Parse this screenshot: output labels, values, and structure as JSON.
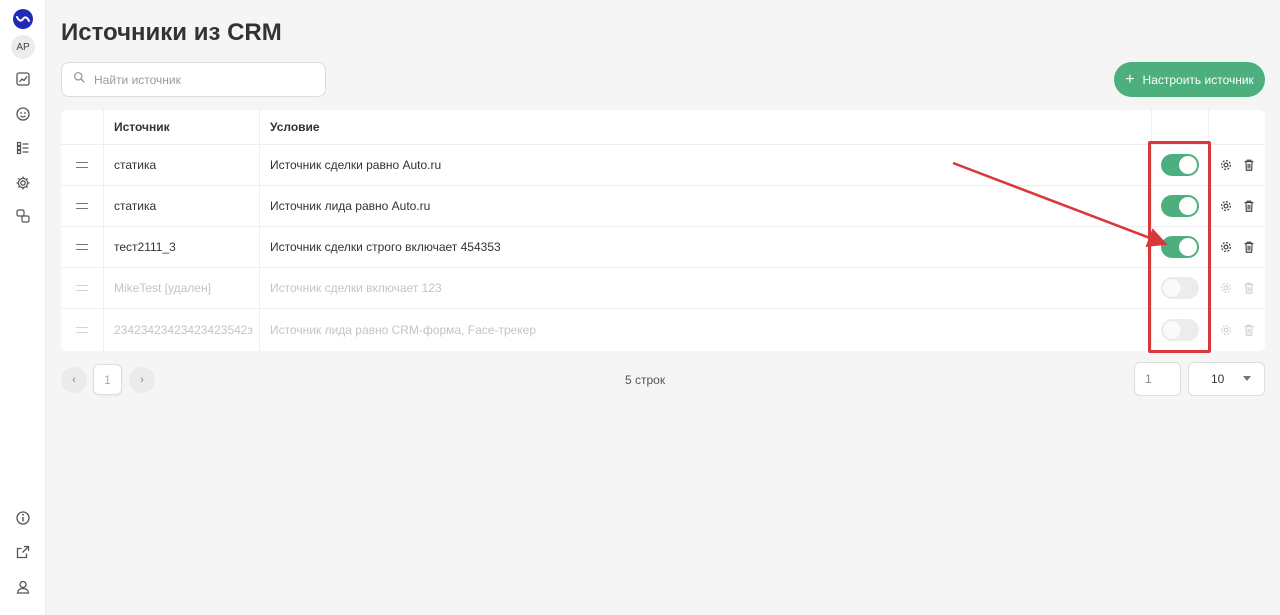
{
  "sidebar": {
    "avatar_initials": "AP",
    "items": [
      {
        "icon": "analytics-icon"
      },
      {
        "icon": "emoji-icon"
      },
      {
        "icon": "list-icon"
      },
      {
        "icon": "gear-icon"
      },
      {
        "icon": "integrations-icon"
      }
    ],
    "bottom_items": [
      {
        "icon": "info-icon"
      },
      {
        "icon": "external-link-icon"
      },
      {
        "icon": "user-icon"
      }
    ]
  },
  "page": {
    "title": "Источники из CRM"
  },
  "search": {
    "placeholder": "Найти источник",
    "value": ""
  },
  "actions": {
    "add_label": "Настроить источник",
    "add_icon": "plus-icon"
  },
  "table": {
    "headers": {
      "source": "Источник",
      "condition": "Условие"
    },
    "rows": [
      {
        "source": "статика",
        "condition": "Источник сделки равно Auto.ru",
        "enabled": true
      },
      {
        "source": "статика",
        "condition": "Источник лида равно Auto.ru",
        "enabled": true
      },
      {
        "source": "тест2111_3",
        "condition": "Источник сделки строго включает 454353",
        "enabled": true
      },
      {
        "source": "MikeTest [удален]",
        "condition": "Источник сделки включает 123",
        "enabled": false
      },
      {
        "source": "23423423423423423542з",
        "condition": "Источник лида равно CRM-форма, Face-трекер",
        "enabled": false
      }
    ]
  },
  "pagination": {
    "prev": "‹",
    "next": "›",
    "current_page": "1",
    "rows_count": "5 строк",
    "page_input": "1",
    "per_page": "10"
  },
  "colors": {
    "accent": "#4caf7d",
    "annotation": "#d9383a",
    "logo": "#1f2bb8"
  }
}
